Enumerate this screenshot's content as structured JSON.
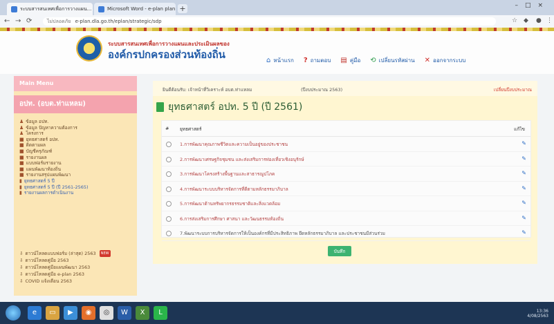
{
  "browser": {
    "tabs": [
      {
        "title": "ระบบสารสนเทศเพื่อการวางแผน..."
      },
      {
        "title": "Microsoft Word - e-plan plan.m..."
      }
    ],
    "new_tab": "+",
    "address": {
      "security": "ไม่ปลอดภัย",
      "url": "e-plan.dla.go.th/eplan/strategic/sdp"
    }
  },
  "site": {
    "title_line1": "ระบบสารสนเทศเพื่อการวางแผนและประเมินผลของ",
    "title_line2": "องค์กรปกครองส่วนท้องถิ่น",
    "nav": [
      {
        "label": "หน้าแรก",
        "icon": "home-icon"
      },
      {
        "label": "ถามตอบ",
        "icon": "help-icon"
      },
      {
        "label": "คู่มือ",
        "icon": "book-icon"
      },
      {
        "label": "เปลี่ยนรหัสผ่าน",
        "icon": "sync-icon"
      },
      {
        "label": "ออกจากระบบ",
        "icon": "close-icon"
      }
    ]
  },
  "sidebar": {
    "main_menu": "Main Menu",
    "org": "อปท. (อบต.ท่าแหลม)",
    "items": [
      "ข้อมูล อปท.",
      "ข้อมูล ปัญหาความต้องการ",
      "โครงการ",
      "ยุทธศาสตร์ อปท.",
      "ติดตามผล",
      "บัญชีครุภัณฑ์",
      "รายงานผล",
      "แบบฟอร์มรายงาน",
      "แผนพัฒนาท้องถิ่น",
      "รายงานสรุปแผนพัฒนา",
      "ยุทธศาสตร์ 5 ปี",
      "ยุทธศาสตร์ 5 ปี (ปี 2561-2565)",
      "รายงานผลการดำเนินงาน"
    ],
    "downloads": [
      "ดาวน์โหลดแบบฟอร์ม (ล่าสุด) 2563",
      "ดาวน์โหลดคู่มือ 2563",
      "ดาวน์โหลดคู่มือแผนพัฒนา 2563",
      "ดาวน์โหลดคู่มือ e-plan 2563",
      "COVID แจ้งเตือน 2563"
    ],
    "new_badge": "NEW"
  },
  "panel": {
    "crumb": "ยินดีต้อนรับ: เจ้าหน้าที่วิเคราะห์ อบต.ท่าแหลม",
    "fiscal": "(ปีงบประมาณ 2563)",
    "change_year": "เปลี่ยนปีงบประมาณ",
    "title": "ยุทธศาสตร์ อปท. 5 ปี (ปี 2561)",
    "table": {
      "col_no": "#",
      "col_name": "ยุทธศาสตร์",
      "col_action": "แก้ไข",
      "rows": [
        "1.การพัฒนาคุณภาพชีวิตและความเป็นอยู่ของประชาชน",
        "2.การพัฒนาเศรษฐกิจชุมชน และส่งเสริมการท่องเที่ยวเชิงอนุรักษ์",
        "3.การพัฒนาโครงสร้างพื้นฐานและสาธารณูปโภค",
        "4.การพัฒนาระบบบริหารจัดการที่ดีตามหลักธรรมาภิบาล",
        "5.การพัฒนาด้านทรัพยากรธรรมชาติและสิ่งแวดล้อม",
        "6.การส่งเสริมการศึกษา ศาสนา และวัฒนธรรมท้องถิ่น",
        "7.พัฒนาระบบการบริหารจัดการให้เป็นองค์กรที่มีประสิทธิภาพ ยึดหลักธรรมาภิบาล และประชาชนมีส่วนร่วม"
      ]
    },
    "save": "บันทึก"
  },
  "taskbar": {
    "time": "13:36",
    "date": "4/08/2563"
  }
}
